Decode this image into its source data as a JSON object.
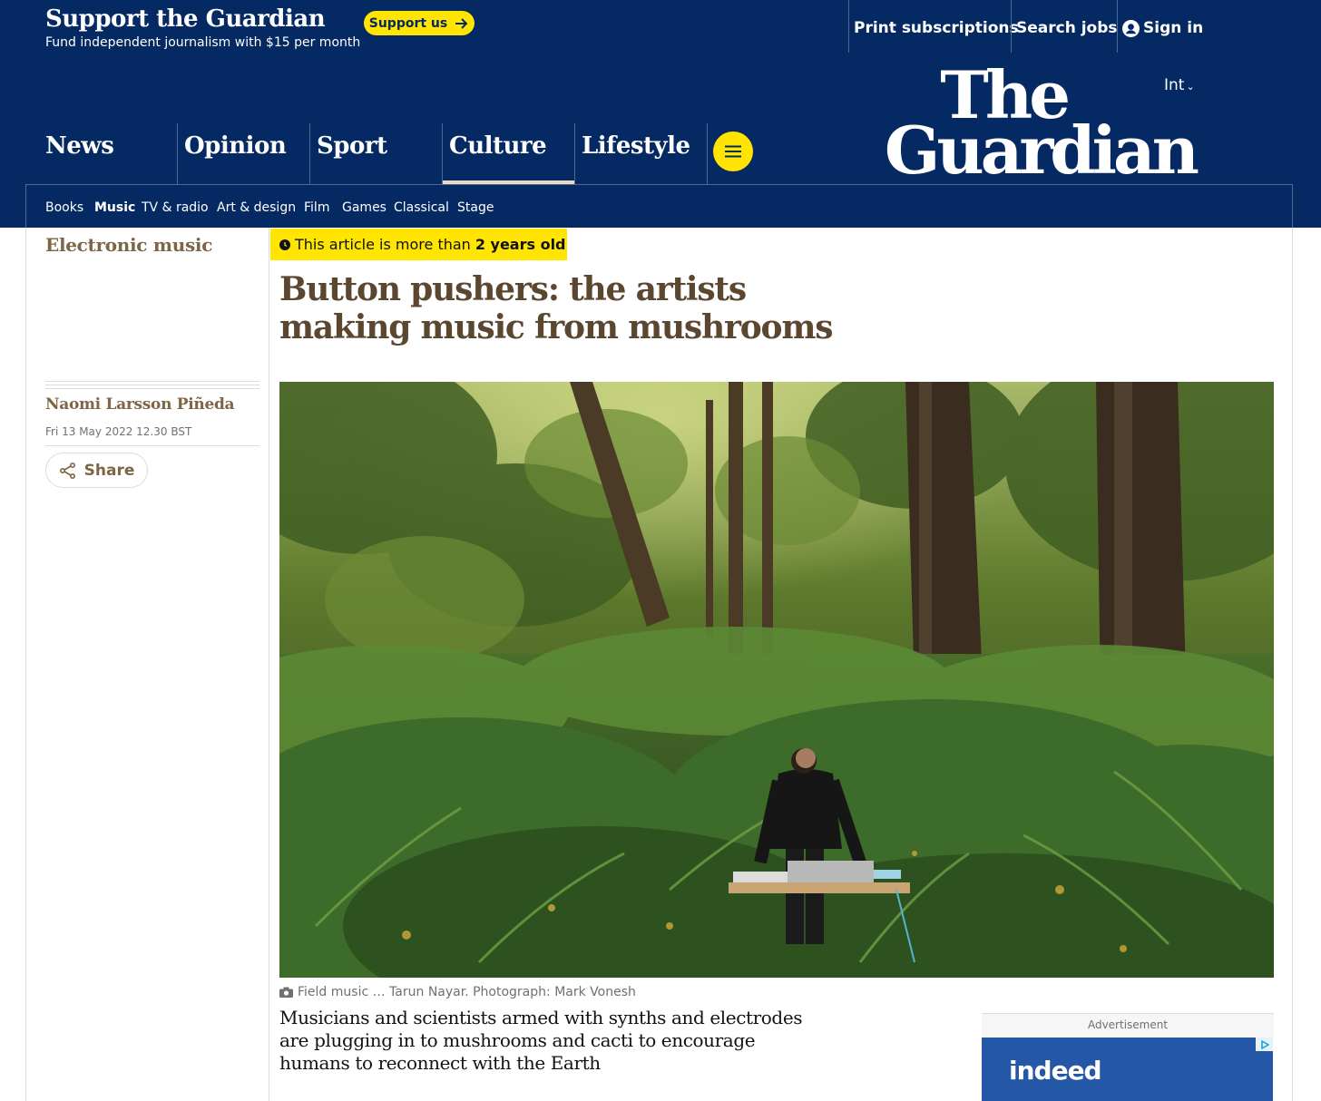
{
  "support": {
    "title": "Support the Guardian",
    "subtitle": "Fund independent journalism with $15 per month",
    "button_label": "Support us"
  },
  "top_links": {
    "print": "Print subscriptions",
    "jobs": "Search jobs",
    "signin": "Sign in"
  },
  "header": {
    "edition": "Int",
    "logo_line1": "The",
    "logo_line2": "Guardian",
    "pillars": [
      "News",
      "Opinion",
      "Sport",
      "Culture",
      "Lifestyle"
    ],
    "active_pillar": "Culture",
    "subnav": [
      "Books",
      "Music",
      "TV & radio",
      "Art & design",
      "Film",
      "Games",
      "Classical",
      "Stage"
    ],
    "active_subnav": "Music"
  },
  "article": {
    "section": "Electronic music",
    "age_prefix": "This article is more than",
    "age_value": "2 years old",
    "headline": "Button pushers: the artists making music from mushrooms",
    "author": "Naomi Larsson Piñeda",
    "date": "Fri 13 May 2022 12.30 BST",
    "share_label": "Share",
    "caption": "Field music … Tarun Nayar. Photograph: Mark Vonesh",
    "standfirst": "Musicians and scientists armed with synths and electrodes are plugging in to mushrooms and cacti to encourage humans to reconnect with the Earth"
  },
  "ad": {
    "label": "Advertisement",
    "brand": "indeed"
  },
  "colors": {
    "brand_blue": "#052962",
    "support_yellow": "#ffe500",
    "culture_accent": "#7d6545",
    "headline_brown": "#5b4630"
  }
}
